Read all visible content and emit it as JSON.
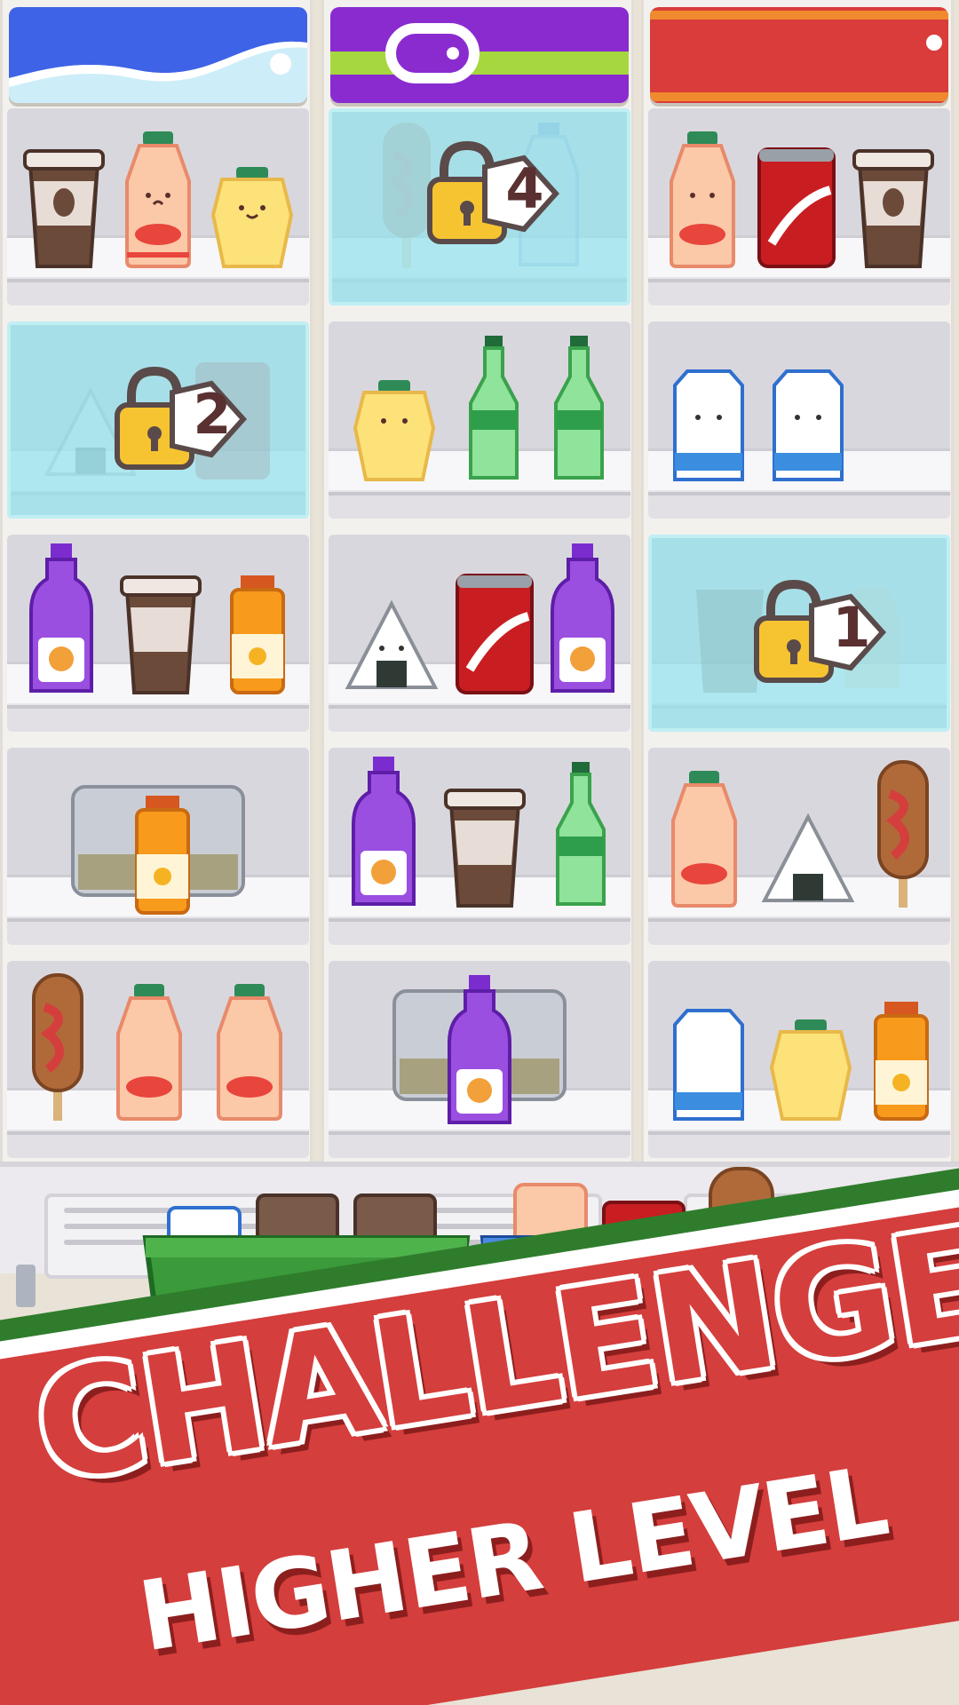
{
  "banner": {
    "headline": "CHALLENGE",
    "subline": "HIGHER LEVEL"
  },
  "locks": [
    {
      "count": "4"
    },
    {
      "count": "2"
    },
    {
      "count": "1"
    }
  ],
  "colors": {
    "banner_red": "#d43e3c",
    "banner_green": "#2f7d2c",
    "frozen_ice": "#96e1eb",
    "lock_gold": "#f6c431",
    "basket_green": "#3b9a3a",
    "basket_blue": "#2f6fcf"
  },
  "shelves": [
    {
      "id": "r1c1",
      "items": [
        "coffee-cup",
        "yogurt-bottle",
        "pudding-cup"
      ]
    },
    {
      "id": "r1c2",
      "frozen": true,
      "lock": "4",
      "items": [
        "corn-dog",
        "water-bottle"
      ]
    },
    {
      "id": "r1c3",
      "items": [
        "yogurt-bottle",
        "cola-can",
        "coffee-cup"
      ]
    },
    {
      "id": "r2c1",
      "frozen": true,
      "lock": "2",
      "items": [
        "onigiri",
        "cola-can"
      ]
    },
    {
      "id": "r2c2",
      "items": [
        "pudding-cup",
        "soda-bottle",
        "soda-bottle"
      ]
    },
    {
      "id": "r2c3",
      "items": [
        "milk-carton",
        "milk-carton"
      ]
    },
    {
      "id": "r3c1",
      "items": [
        "grape-bottle",
        "coffee-cup",
        "orange-juice"
      ]
    },
    {
      "id": "r3c2",
      "items": [
        "onigiri",
        "cola-can",
        "grape-bottle"
      ]
    },
    {
      "id": "r3c3",
      "frozen": true,
      "lock": "1",
      "items": [
        "coffee-cup",
        "yogurt-bottle"
      ]
    },
    {
      "id": "r4c1",
      "items": [
        "orange-juice"
      ]
    },
    {
      "id": "r4c2",
      "items": [
        "grape-bottle",
        "coffee-cup",
        "soda-bottle"
      ]
    },
    {
      "id": "r4c3",
      "items": [
        "yogurt-bottle",
        "onigiri",
        "corn-dog"
      ]
    },
    {
      "id": "r5c1",
      "items": [
        "corn-dog",
        "yogurt-bottle",
        "yogurt-bottle"
      ]
    },
    {
      "id": "r5c2",
      "items": [
        "grape-bottle"
      ]
    },
    {
      "id": "r5c3",
      "items": [
        "milk-carton",
        "pudding-cup",
        "orange-juice"
      ]
    }
  ],
  "baskets": [
    {
      "color": "green",
      "items": [
        "milk-carton",
        "iced-coffee",
        "iced-coffee"
      ]
    },
    {
      "color": "blue",
      "items": [
        "yogurt-bottle",
        "cola-can",
        "corn-dog"
      ]
    }
  ]
}
